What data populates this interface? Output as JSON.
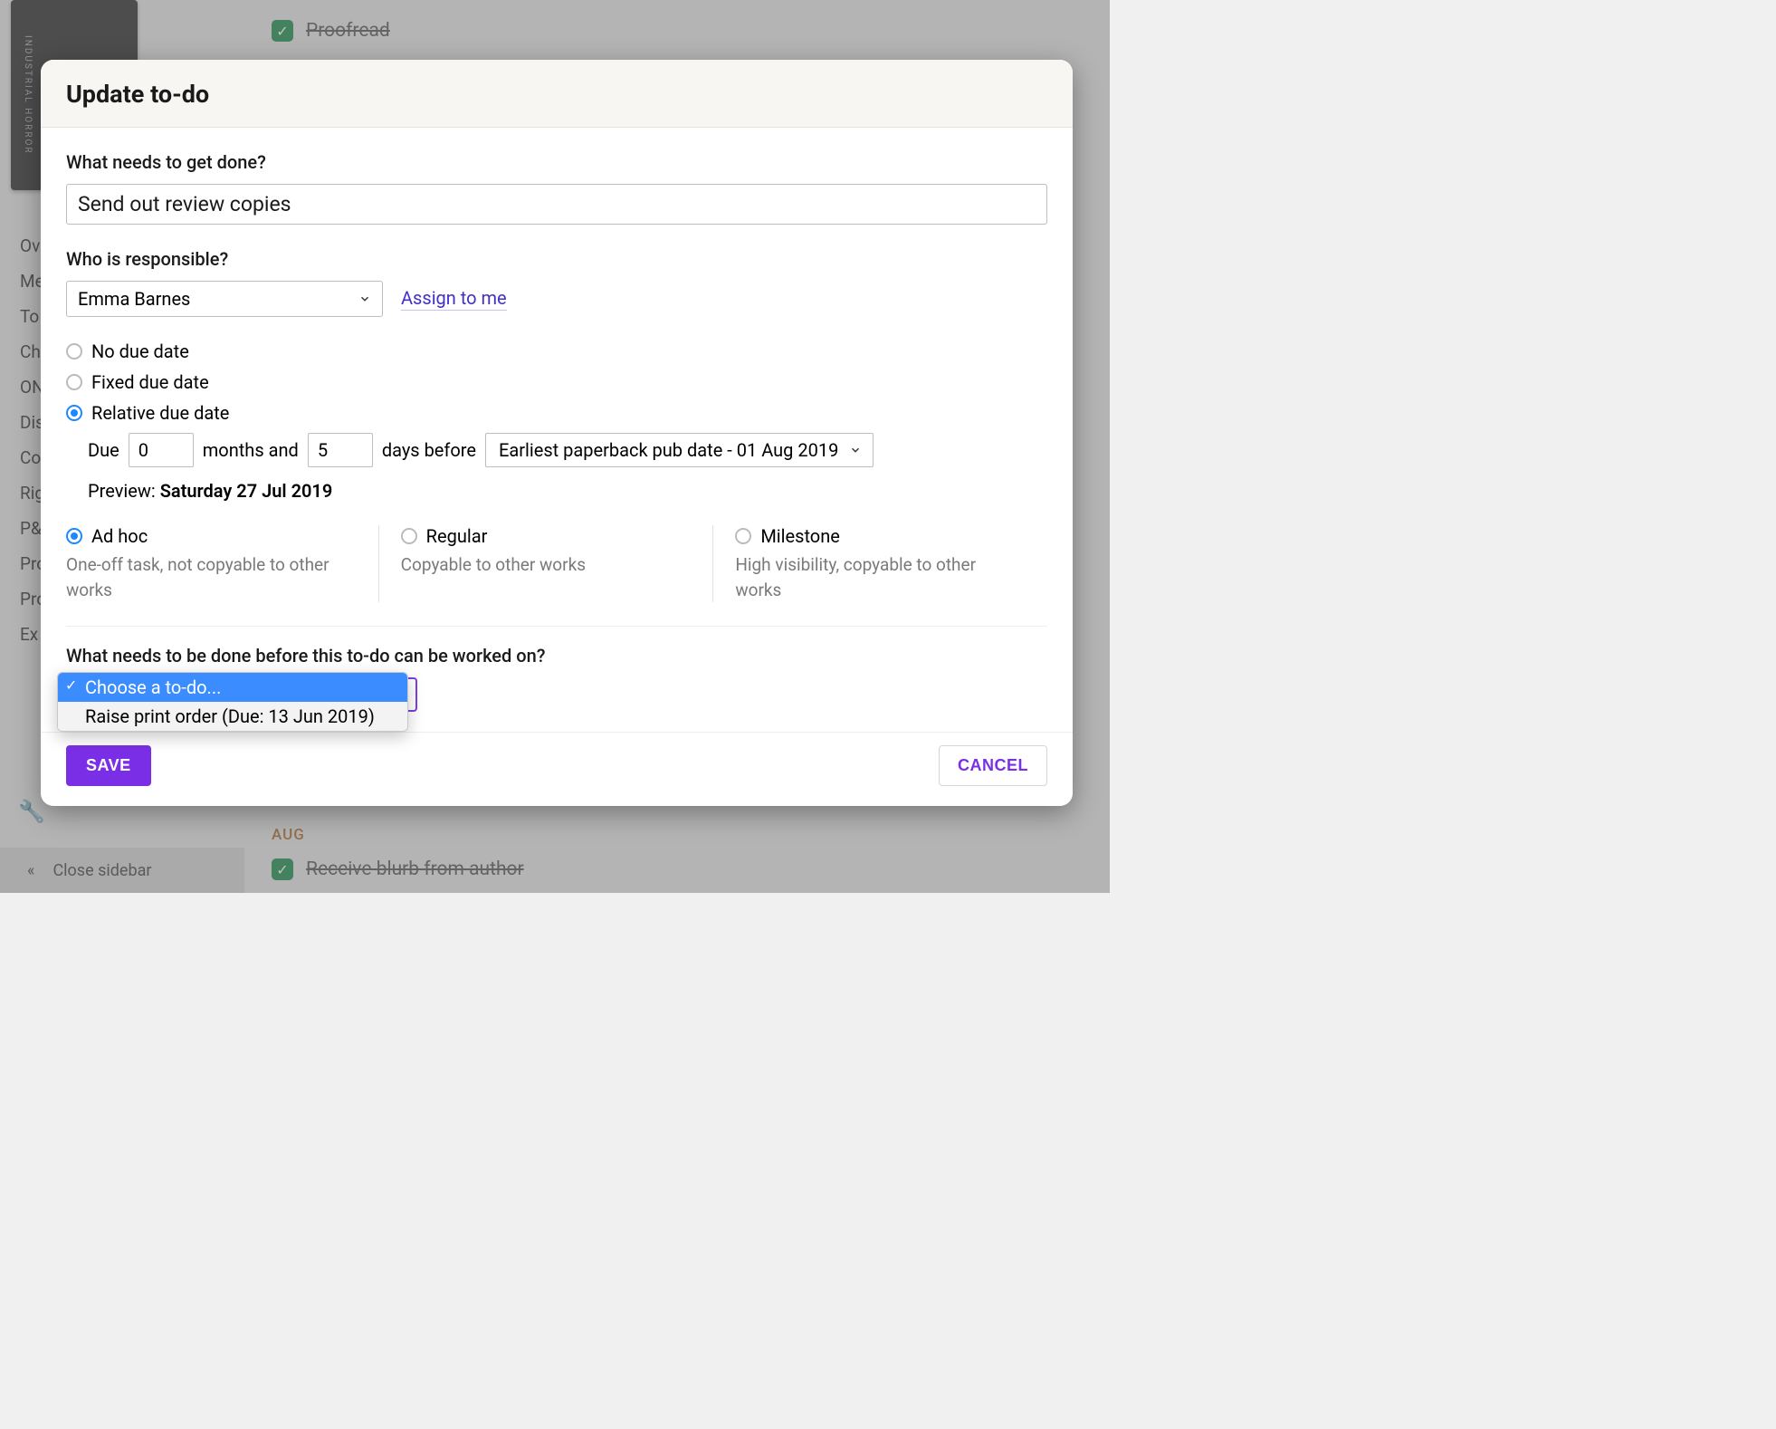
{
  "background": {
    "thumb_spine": "INDUSTRIAL HORROR",
    "sidebar_items": [
      "Ov",
      "Me",
      "To",
      "Ch",
      "ON",
      "Dis",
      "Co",
      "Rig",
      "P&",
      "Pro",
      "Pro",
      "Ex"
    ],
    "close_sidebar": "Close sidebar",
    "collapse_icon": "«",
    "completed_top": "Proofread",
    "month_label": "AUG",
    "completed_bottom": "Receive blurb from author"
  },
  "modal": {
    "title": "Update to-do",
    "what_label": "What needs to get done?",
    "what_value": "Send out review copies",
    "who_label": "Who is responsible?",
    "who_value": "Emma Barnes",
    "assign_link": "Assign to me",
    "due": {
      "no_label": "No due date",
      "fixed_label": "Fixed due date",
      "relative_label": "Relative due date",
      "due_word": "Due",
      "months": "0",
      "months_and": "months and",
      "days": "5",
      "days_before": "days before",
      "ref_select": "Earliest paperback pub date - 01 Aug 2019",
      "preview_label": "Preview:",
      "preview_value": "Saturday 27 Jul 2019"
    },
    "types": {
      "adhoc": {
        "title": "Ad hoc",
        "desc": "One-off task, not copyable to other works"
      },
      "regular": {
        "title": "Regular",
        "desc": "Copyable to other works"
      },
      "milestone": {
        "title": "Milestone",
        "desc": "High visibility, copyable to other works"
      }
    },
    "dep": {
      "label": "What needs to be done before this to-do can be worked on?",
      "placeholder": "Choose a to-do...",
      "options": [
        "Raise print order (Due: 13 Jun 2019)"
      ]
    },
    "save": "SAVE",
    "cancel": "CANCEL"
  }
}
